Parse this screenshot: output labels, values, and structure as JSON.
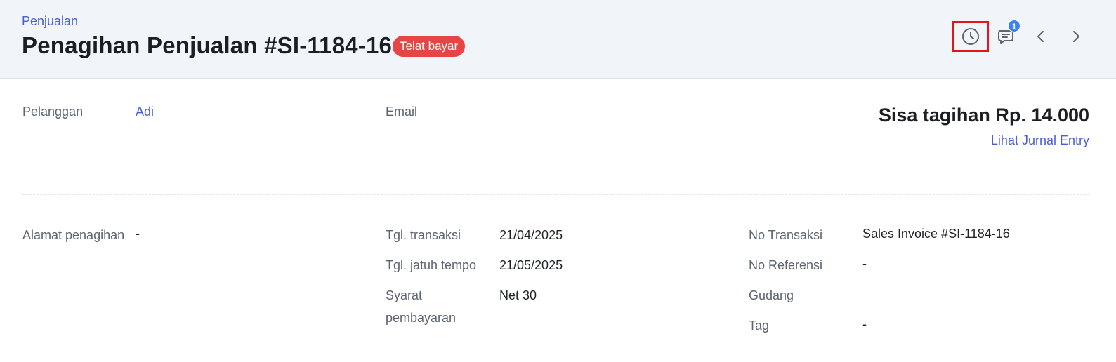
{
  "header": {
    "breadcrumb": "Penjualan",
    "title": "Penagihan Penjualan #SI-1184-16",
    "status": "Telat bayar",
    "comment_count": "1"
  },
  "icons": {
    "history": "clock-icon",
    "comments": "comment-icon",
    "prev": "chevron-left-icon",
    "next": "chevron-right-icon"
  },
  "colors": {
    "accent": "#4a5fd4",
    "status_overdue": "#e54545",
    "header_bg": "#f1f4f9",
    "badge_blue": "#3b82f6",
    "highlight_box": "#e3141a"
  },
  "summary": {
    "customer_label": "Pelanggan",
    "customer_value": "Adi",
    "email_label": "Email",
    "balance": "Sisa tagihan Rp. 14.000",
    "journal_link": "Lihat Jurnal Entry"
  },
  "details": {
    "billing_address_label": "Alamat penagihan",
    "billing_address_value": "-",
    "transaction_date_label": "Tgl. transaksi",
    "transaction_date_value": "21/04/2025",
    "due_date_label": "Tgl. jatuh tempo",
    "due_date_value": "21/05/2025",
    "payment_terms_label_line1": "Syarat",
    "payment_terms_label_line2": "pembayaran",
    "payment_terms_value": "Net 30",
    "transaction_no_label": "No Transaksi",
    "transaction_no_value": "Sales Invoice #SI-1184-16",
    "reference_no_label": "No Referensi",
    "reference_no_value": "-",
    "warehouse_label": "Gudang",
    "tag_label": "Tag",
    "tag_value": "-"
  }
}
